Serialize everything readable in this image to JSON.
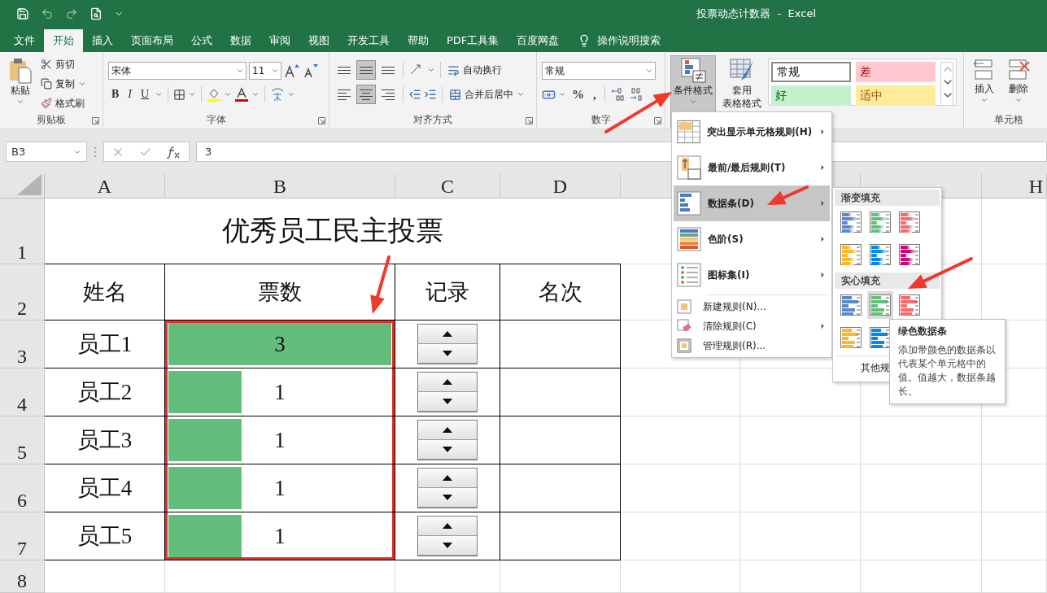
{
  "window": {
    "title": "投票动态计数器  -  Excel"
  },
  "tabs": [
    {
      "label": "文件",
      "selected": false
    },
    {
      "label": "开始",
      "selected": true
    },
    {
      "label": "插入",
      "selected": false
    },
    {
      "label": "页面布局",
      "selected": false
    },
    {
      "label": "公式",
      "selected": false
    },
    {
      "label": "数据",
      "selected": false
    },
    {
      "label": "审阅",
      "selected": false
    },
    {
      "label": "视图",
      "selected": false
    },
    {
      "label": "开发工具",
      "selected": false
    },
    {
      "label": "帮助",
      "selected": false
    },
    {
      "label": "PDF工具集",
      "selected": false
    },
    {
      "label": "百度网盘",
      "selected": false
    }
  ],
  "search": {
    "label": "操作说明搜索"
  },
  "clipboard": {
    "label": "剪贴板",
    "paste": "粘贴",
    "tools": [
      "剪切",
      "复制",
      "格式刷"
    ]
  },
  "font": {
    "label": "字体",
    "name": "宋体",
    "size": "11",
    "styles": [
      "B",
      "I",
      "U"
    ]
  },
  "alignment": {
    "label": "对齐方式",
    "buttons": [
      {
        "kind": "top",
        "selected": false
      },
      {
        "kind": "middle",
        "selected": true
      },
      {
        "kind": "bottom",
        "selected": false
      },
      {
        "kind": "left",
        "selected": false
      },
      {
        "kind": "center",
        "selected": true
      },
      {
        "kind": "right",
        "selected": false
      }
    ],
    "wrap": "自动换行",
    "merge": "合并后居中"
  },
  "number": {
    "label": "数字",
    "format": "常规",
    "symbols": [
      "%",
      ","
    ]
  },
  "styles": {
    "conditional": {
      "label": "条件格式",
      "pressed": true
    },
    "table_format": [
      "套用",
      "表格格式"
    ],
    "cell_styles": [
      {
        "label": "常规",
        "color": "#ffffff"
      },
      {
        "label": "差",
        "color": "#ffc7ce"
      },
      {
        "label": "好",
        "color": "#c6efce"
      },
      {
        "label": "适中",
        "color": "#ffeb9c"
      }
    ]
  },
  "cells": {
    "label": "单元格",
    "buttons": [
      "插入",
      "删除"
    ]
  },
  "formula_bar": {
    "name_box": "B3",
    "formula": "3"
  },
  "columns": {
    "left": [
      "A",
      "B",
      "C",
      "D"
    ],
    "right": [
      "H"
    ]
  },
  "rows": [
    "1",
    "2",
    "3",
    "4",
    "5",
    "6",
    "7",
    "8"
  ],
  "sheet": {
    "title": "优秀员工民主投票",
    "headers": [
      "姓名",
      "票数",
      "记录",
      "名次"
    ],
    "records": [
      {
        "name": "员工1",
        "votes": "3",
        "level": 1
      },
      {
        "name": "员工2",
        "votes": "1",
        "level": 0.33
      },
      {
        "name": "员工3",
        "votes": "1",
        "level": 0.33
      },
      {
        "name": "员工4",
        "votes": "1",
        "level": 0.33
      },
      {
        "name": "员工5",
        "votes": "1",
        "level": 0.33
      }
    ]
  },
  "menu": {
    "items": [
      {
        "kind": "highlight",
        "label": "突出显示单元格规则(H)",
        "submenu": true,
        "selected": false
      },
      {
        "kind": "topbottom",
        "label": "最前/最后规则(T)",
        "submenu": true,
        "selected": false
      },
      {
        "kind": "databar",
        "label": "数据条(D)",
        "submenu": true,
        "selected": true
      },
      {
        "kind": "colorscale",
        "label": "色阶(S)",
        "submenu": true,
        "selected": false
      },
      {
        "kind": "iconset",
        "label": "图标集(I)",
        "submenu": true,
        "selected": false
      },
      {
        "kind": "new",
        "label": "新建规则(N)...",
        "submenu": false,
        "selected": false
      },
      {
        "kind": "clear",
        "label": "清除规则(C)",
        "submenu": true,
        "selected": false
      },
      {
        "kind": "manage",
        "label": "管理规则(R)...",
        "submenu": false,
        "selected": false
      }
    ]
  },
  "submenu": {
    "sections": [
      {
        "title": "渐变填充",
        "swatches": [
          {
            "color": "#5a8ac6",
            "selected": false
          },
          {
            "color": "#63be7b",
            "selected": false
          },
          {
            "color": "#f8696b",
            "selected": false
          },
          {
            "color": "#ffb628",
            "selected": false
          },
          {
            "color": "#008aef",
            "selected": false
          },
          {
            "color": "#d6007b",
            "selected": false
          }
        ]
      },
      {
        "title": "实心填充",
        "swatches": [
          {
            "color": "#5a8ac6",
            "selected": false
          },
          {
            "color": "#63be7b",
            "selected": true
          },
          {
            "color": "#f8696b",
            "selected": false
          },
          {
            "color": "#ffb628",
            "selected": false
          },
          {
            "color": "#008aef",
            "selected": false
          }
        ]
      }
    ],
    "footer": "其他规"
  },
  "tooltip": {
    "title": "绿色数据条",
    "body": "添加带颜色的数据条以代表某个单元格中的值。值越大，数据条越长。"
  }
}
